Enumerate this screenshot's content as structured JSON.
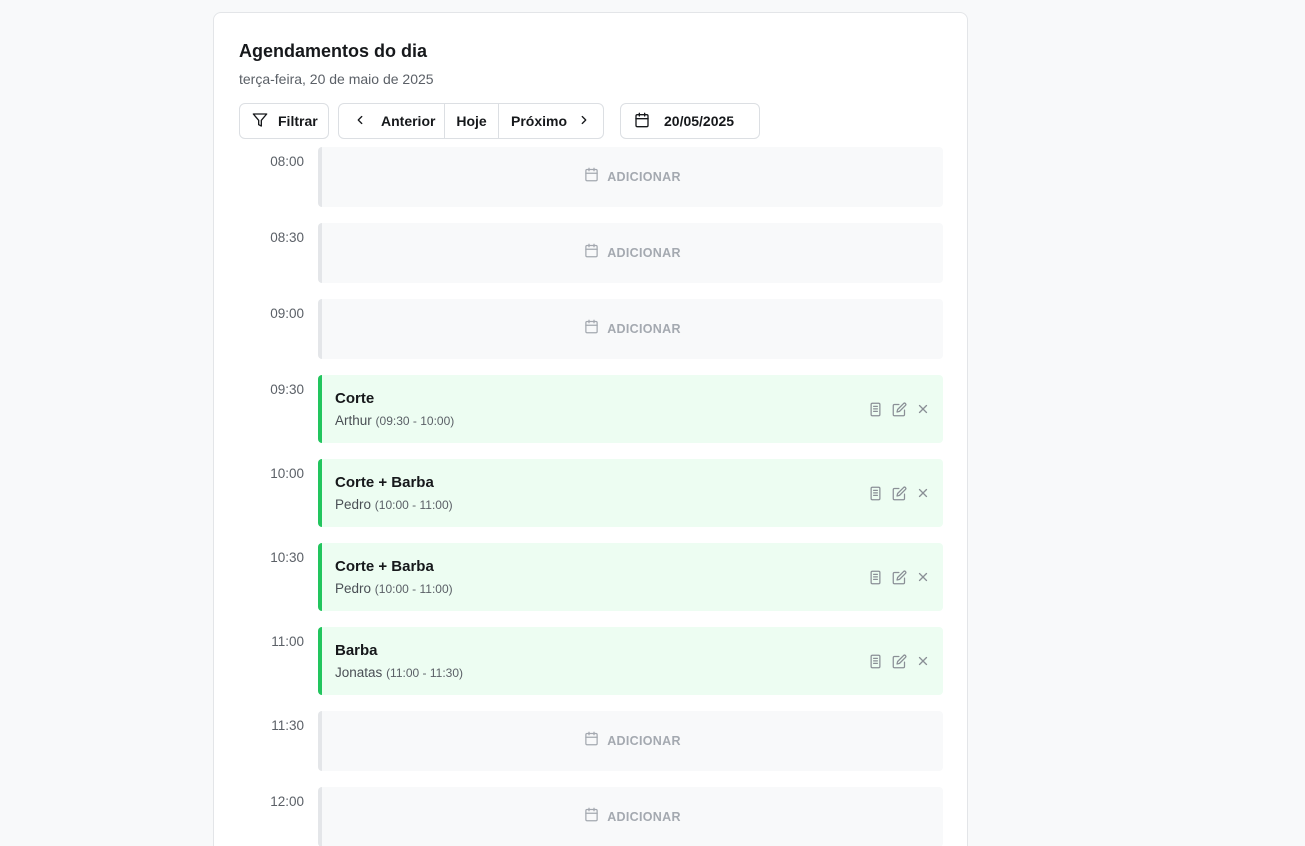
{
  "header": {
    "title": "Agendamentos do dia",
    "subtitle": "terça-feira, 20 de maio de 2025"
  },
  "toolbar": {
    "filter_label": "Filtrar",
    "prev_label": "Anterior",
    "today_label": "Hoje",
    "next_label": "Próximo",
    "date_value": "20/05/2025"
  },
  "colors": {
    "booked_accent": "#22c55e",
    "booked_bg": "#edfdf2",
    "empty_bg": "#f8f9fa"
  },
  "slots": [
    {
      "time": "08:00",
      "status": "empty",
      "add_label": "ADICIONAR"
    },
    {
      "time": "08:30",
      "status": "empty",
      "add_label": "ADICIONAR"
    },
    {
      "time": "09:00",
      "status": "empty",
      "add_label": "ADICIONAR"
    },
    {
      "time": "09:30",
      "status": "booked",
      "service": "Corte",
      "client": "Arthur",
      "range": "(09:30 - 10:00)"
    },
    {
      "time": "10:00",
      "status": "booked",
      "service": "Corte + Barba",
      "client": "Pedro",
      "range": "(10:00 - 11:00)"
    },
    {
      "time": "10:30",
      "status": "booked",
      "service": "Corte + Barba",
      "client": "Pedro",
      "range": "(10:00 - 11:00)"
    },
    {
      "time": "11:00",
      "status": "booked",
      "service": "Barba",
      "client": "Jonatas",
      "range": "(11:00 - 11:30)"
    },
    {
      "time": "11:30",
      "status": "empty",
      "add_label": "ADICIONAR"
    },
    {
      "time": "12:00",
      "status": "empty",
      "add_label": "ADICIONAR"
    }
  ]
}
